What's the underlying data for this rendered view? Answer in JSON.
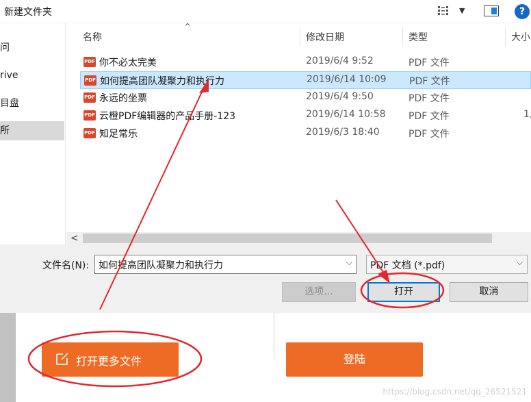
{
  "toolbar": {
    "new_folder_label": "新建文件夹",
    "help_label": "?"
  },
  "nav": {
    "items": [
      "问",
      "rive",
      "目盘",
      "所"
    ]
  },
  "columns": {
    "name": "名称",
    "date": "修改日期",
    "type": "类型",
    "size": "大小"
  },
  "files": [
    {
      "name": "你不必太完美",
      "date": "2019/6/4 9:52",
      "type": "PDF 文件",
      "size": ""
    },
    {
      "name": "如何提高团队凝聚力和执行力",
      "date": "2019/6/14 10:09",
      "type": "PDF 文件",
      "size": ""
    },
    {
      "name": "永远的坐票",
      "date": "2019/6/4 9:50",
      "type": "PDF 文件",
      "size": ""
    },
    {
      "name": "云橙PDF编辑器的产品手册-123",
      "date": "2019/6/14 10:58",
      "type": "PDF 文件",
      "size": "1,"
    },
    {
      "name": "知足常乐",
      "date": "2019/6/3 18:40",
      "type": "PDF 文件",
      "size": ""
    }
  ],
  "file_icon_text": "PDF",
  "selected_index": 1,
  "scrollbar": {
    "left_arrow": "<"
  },
  "dialog": {
    "filename_label": "文件名(N):",
    "filename_value": "如何提高团队凝聚力和执行力",
    "filter_value": "PDF 文档 (*.pdf)",
    "options_label": "选项...",
    "open_label": "打开",
    "cancel_label": "取消"
  },
  "app": {
    "open_more_label": "打开更多文件",
    "login_label": "登陆",
    "watermark": "https://blog.csdn.net/qq_26521521"
  },
  "colors": {
    "accent_orange": "#ee6b26",
    "selection_blue": "#cce8ff",
    "focus_blue": "#0078d7",
    "annotation_red": "#e5262a"
  }
}
